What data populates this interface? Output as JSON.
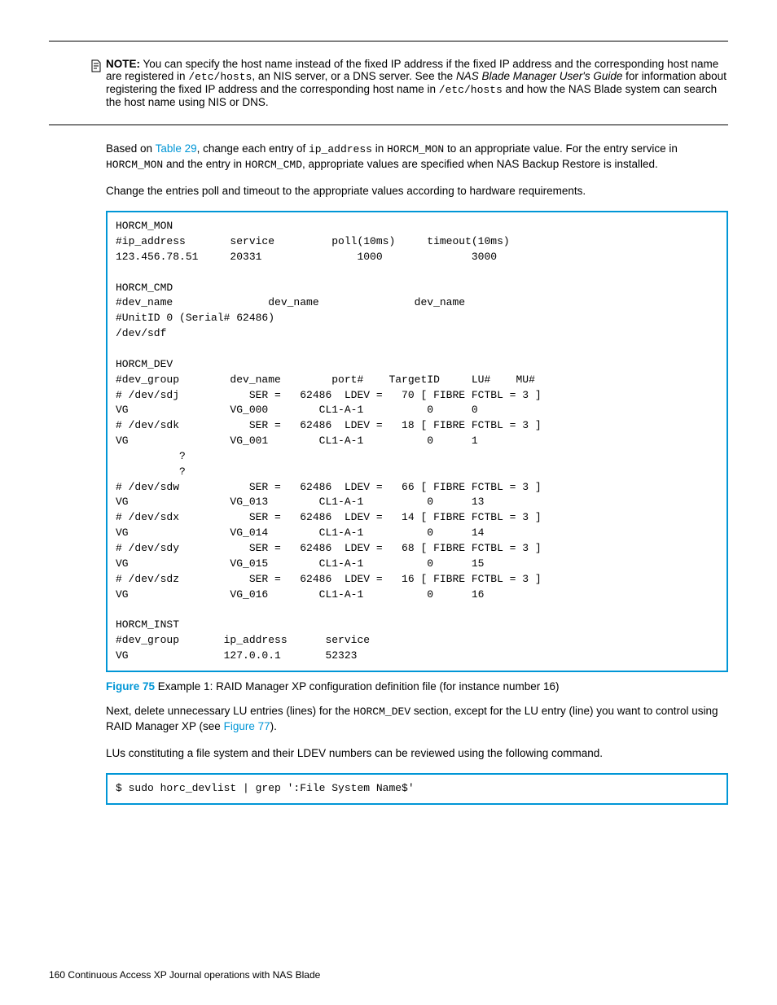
{
  "note": {
    "label": "NOTE:",
    "text1": "You can specify the host name instead of the fixed IP address if the fixed IP address and the corresponding host name are registered in ",
    "etc": "/etc/hosts",
    "text2": ", an NIS server, or a DNS server. See the ",
    "guide": "NAS Blade Manager User's Guide",
    "text3": " for information about registering the fixed IP address and the corresponding host name in ",
    "etc2": "/etc/hosts",
    "text4": " and how the NAS Blade system can search the host name using NIS or DNS."
  },
  "p1": {
    "t1": "Based on ",
    "link": "Table 29",
    "t2": ", change each entry of ",
    "m1": "ip_address",
    "t3": " in ",
    "m2": "HORCM_MON",
    "t4": " to an appropriate value. For the entry service in ",
    "m3": "HORCM_MON",
    "t5": " and the entry in ",
    "m4": "HORCM_CMD",
    "t6": ", appropriate values are specified when NAS Backup Restore is installed."
  },
  "p2": "Change the entries poll and timeout to the appropriate values according to hardware requirements.",
  "code1": "HORCM_MON\n#ip_address       service         poll(10ms)     timeout(10ms)\n123.456.78.51     20331               1000              3000\n\nHORCM_CMD\n#dev_name               dev_name               dev_name\n#UnitID 0 (Serial# 62486)\n/dev/sdf\n\nHORCM_DEV\n#dev_group        dev_name        port#    TargetID     LU#    MU#\n# /dev/sdj           SER =   62486  LDEV =   70 [ FIBRE FCTBL = 3 ]\nVG                VG_000        CL1-A-1          0      0\n# /dev/sdk           SER =   62486  LDEV =   18 [ FIBRE FCTBL = 3 ]\nVG                VG_001        CL1-A-1          0      1\n          ?\n          ?\n# /dev/sdw           SER =   62486  LDEV =   66 [ FIBRE FCTBL = 3 ]\nVG                VG_013        CL1-A-1          0      13\n# /dev/sdx           SER =   62486  LDEV =   14 [ FIBRE FCTBL = 3 ]\nVG                VG_014        CL1-A-1          0      14\n# /dev/sdy           SER =   62486  LDEV =   68 [ FIBRE FCTBL = 3 ]\nVG                VG_015        CL1-A-1          0      15\n# /dev/sdz           SER =   62486  LDEV =   16 [ FIBRE FCTBL = 3 ]\nVG                VG_016        CL1-A-1          0      16\n\nHORCM_INST\n#dev_group       ip_address      service\nVG               127.0.0.1       52323",
  "fig": {
    "label": "Figure 75",
    "caption": "  Example 1: RAID Manager XP configuration definition file (for instance number 16)"
  },
  "p3": {
    "t1": "Next, delete unnecessary LU entries (lines) for the ",
    "m1": "HORCM_DEV",
    "t2": " section, except for the LU entry (line) you want to control using RAID Manager XP (see ",
    "link": "Figure 77",
    "t3": ")."
  },
  "p4": "LUs constituting a file system and their LDEV numbers can be reviewed using the following command.",
  "code2": "$ sudo horc_devlist | grep ':File System Name$'",
  "footer": {
    "page": "160",
    "title": "   Continuous Access XP Journal operations with NAS Blade"
  }
}
